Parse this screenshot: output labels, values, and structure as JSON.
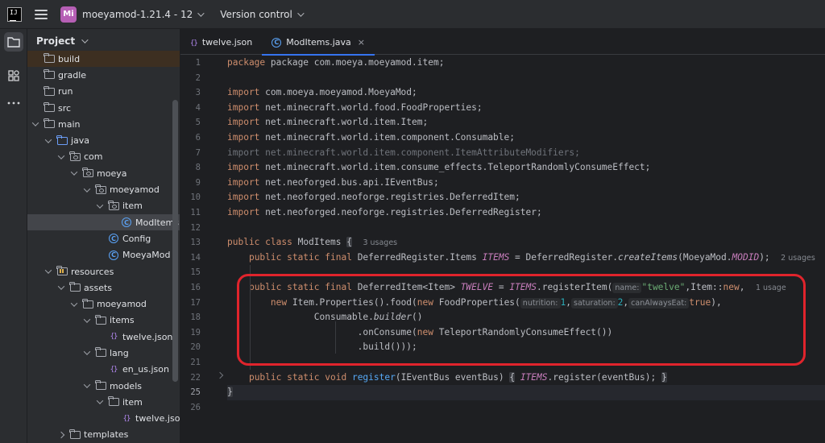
{
  "titlebar": {
    "project_badge": "Mi",
    "project_name": "moeyamod-1.21.4 - 12",
    "vcs_label": "Version control"
  },
  "project_panel": {
    "title": "Project",
    "tree": [
      {
        "label": "build",
        "kind": "folder",
        "depth": 0,
        "arrow": "none"
      },
      {
        "label": "gradle",
        "kind": "folder",
        "depth": 0,
        "arrow": "none"
      },
      {
        "label": "run",
        "kind": "folder",
        "depth": 0,
        "arrow": "none"
      },
      {
        "label": "src",
        "kind": "folder",
        "depth": 0,
        "arrow": "none"
      },
      {
        "label": "main",
        "kind": "folder",
        "depth": 0,
        "arrow": "open"
      },
      {
        "label": "java",
        "kind": "folder-blue",
        "depth": 1,
        "arrow": "open"
      },
      {
        "label": "com",
        "kind": "package",
        "depth": 2,
        "arrow": "open"
      },
      {
        "label": "moeya",
        "kind": "package",
        "depth": 3,
        "arrow": "open"
      },
      {
        "label": "moeyamod",
        "kind": "package",
        "depth": 4,
        "arrow": "open"
      },
      {
        "label": "item",
        "kind": "package",
        "depth": 5,
        "arrow": "open"
      },
      {
        "label": "ModItems",
        "kind": "class",
        "depth": 6,
        "arrow": "none",
        "selected": true
      },
      {
        "label": "Config",
        "kind": "class",
        "depth": 5,
        "arrow": "none"
      },
      {
        "label": "MoeyaMod",
        "kind": "class",
        "depth": 5,
        "arrow": "none"
      },
      {
        "label": "resources",
        "kind": "resources",
        "depth": 1,
        "arrow": "open"
      },
      {
        "label": "assets",
        "kind": "folder",
        "depth": 2,
        "arrow": "open"
      },
      {
        "label": "moeyamod",
        "kind": "folder",
        "depth": 3,
        "arrow": "open"
      },
      {
        "label": "items",
        "kind": "folder",
        "depth": 4,
        "arrow": "open"
      },
      {
        "label": "twelve.json",
        "kind": "json",
        "depth": 5,
        "arrow": "none"
      },
      {
        "label": "lang",
        "kind": "folder",
        "depth": 4,
        "arrow": "open"
      },
      {
        "label": "en_us.json",
        "kind": "json",
        "depth": 5,
        "arrow": "none"
      },
      {
        "label": "models",
        "kind": "folder",
        "depth": 4,
        "arrow": "open"
      },
      {
        "label": "item",
        "kind": "folder",
        "depth": 5,
        "arrow": "open"
      },
      {
        "label": "twelve.json",
        "kind": "json",
        "depth": 6,
        "arrow": "none"
      },
      {
        "label": "templates",
        "kind": "folder",
        "depth": 2,
        "arrow": "closed"
      }
    ]
  },
  "tabs": [
    {
      "label": "twelve.json",
      "icon": "json-icon",
      "active": false
    },
    {
      "label": "ModItems.java",
      "icon": "class-icon",
      "active": true,
      "close": "×"
    }
  ],
  "editor": {
    "line_numbers": [
      "1",
      "2",
      "3",
      "4",
      "5",
      "6",
      "7",
      "8",
      "9",
      "10",
      "11",
      "12",
      "13",
      "14",
      "15",
      "16",
      "17",
      "18",
      "19",
      "20",
      "21",
      "22",
      "25",
      "26"
    ],
    "current_line": "25",
    "code": {
      "l1": [
        "package com.moeya.moeyamod.item;"
      ],
      "l3": [
        "com.moeya.moeyamod.MoeyaMod;"
      ],
      "l4": [
        "net.minecraft.world.food.FoodProperties;"
      ],
      "l5": [
        "net.minecraft.world.item.Item;"
      ],
      "l6": [
        "net.minecraft.world.item.component.Consumable;"
      ],
      "l7": [
        "import net.minecraft.world.item.component.ItemAttributeModifiers;"
      ],
      "l8": [
        "net.minecraft.world.item.consume_effects.TeleportRandomlyConsumeEffect;"
      ],
      "l9": [
        "net.neoforged.bus.api.IEventBus;"
      ],
      "l10": [
        "net.neoforged.neoforge.registries.DeferredItem;"
      ],
      "l11": [
        "net.neoforged.neoforge.registries.DeferredRegister;"
      ],
      "import_kw": "import",
      "class_decl": "public class",
      "class_name": "ModItems",
      "usages_3": "3 usages",
      "usages_2": "2 usages",
      "usages_1": "1 usage",
      "items_decl": "public static final",
      "deferred_items": "DeferredRegister.Items",
      "items_field": "ITEMS",
      "create_items": "DeferredRegister.",
      "create_items_m": "createItems",
      "moeyamod": "(MoeyaMod.",
      "modid": "MODID",
      "twelve_type": "DeferredItem<Item>",
      "twelve_field": "TWELVE",
      "register_item": ".registerItem(",
      "hint_name": "name:",
      "twelve_str": "\"twelve\"",
      "item_new": ",Item::",
      "new_kw": "new",
      "new_item_props": "Item.Properties().food(",
      "food_props": "FoodProperties(",
      "hint_nutrition": "nutrition:",
      "nutrition_val": "1",
      "hint_saturation": "saturation:",
      "saturation_val": "2",
      "hint_can_always_eat": "canAlwaysEat:",
      "true_kw": "true",
      "consumable": "Consumable.",
      "builder": "builder",
      "on_consume": ".onConsume(",
      "teleport": "TeleportRandomlyConsumeEffect())",
      "build": ".build()));",
      "void_decl": "public static void",
      "register_m": "register",
      "register_params": "(IEventBus eventBus)",
      "register_body_tail": ".register(eventBus);",
      "close_brace": "}",
      "open_brace": "{"
    }
  },
  "colors": {
    "annotation_box": "#e0242c",
    "accent": "#3574f0"
  }
}
